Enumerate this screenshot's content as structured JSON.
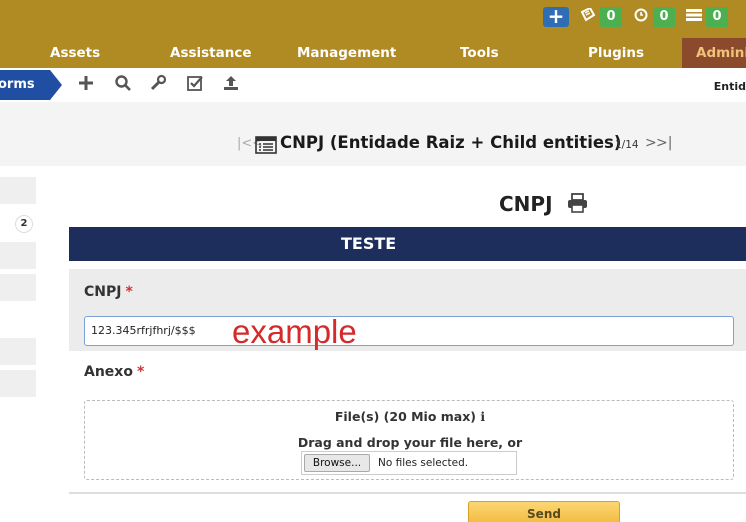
{
  "header": {
    "counts": {
      "tickets": "0",
      "reminders": "0",
      "tasks": "0"
    },
    "nav": [
      "Assets",
      "Assistance",
      "Management",
      "Tools",
      "Plugins",
      "Admini"
    ]
  },
  "toolbar": {
    "breadcrumb": "orms",
    "right_text": "Entid"
  },
  "record_nav": {
    "title": "CNPJ (Entidade Raiz + Child entities)",
    "count": "1/14"
  },
  "left_tabs": {
    "badge": "2"
  },
  "form": {
    "title": "CNPJ",
    "section": "TESTE",
    "field1": {
      "label": "CNPJ",
      "required_mark": "*",
      "value": "123.345rfrjfhrj/$$$"
    },
    "overlay": "example",
    "field2": {
      "label": "Anexo",
      "required_mark": "*"
    },
    "upload": {
      "title": "File(s) (20 Mio max)",
      "info_mark": "ℹ",
      "hint": "Drag and drop your file here, or",
      "browse_label": "Browse...",
      "no_file": "No files selected."
    },
    "submit_label": "Send"
  },
  "colors": {
    "header_bg": "#b08a22",
    "active_nav_bg": "#8b4a2b",
    "breadcrumb_bg": "#1f4ea3",
    "section_bg": "#1d2d5c",
    "badge_green": "#4caf50",
    "submit_yellow": "#f0b83a"
  }
}
